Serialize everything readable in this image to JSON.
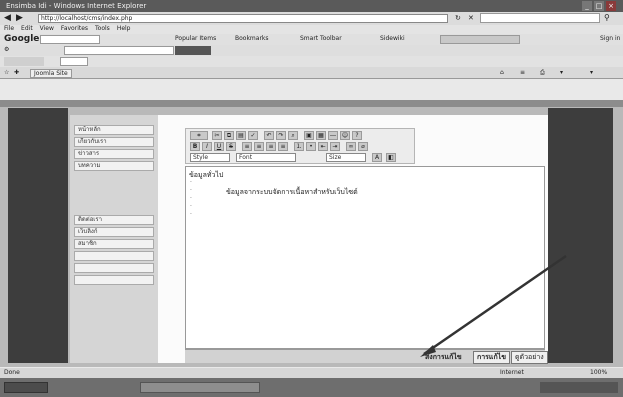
{
  "browser": {
    "title": "Ensimba Idi - Windows Internet Explorer",
    "url": "http://localhost/cms/index.php",
    "menu": [
      "File",
      "Edit",
      "View",
      "Favorites",
      "Tools",
      "Help"
    ],
    "search_brand": "Google",
    "toolbar_labels": [
      "Popular Items",
      "Bookmarks",
      "Smart Toolbar",
      "Sidewiki",
      "Sign in"
    ],
    "fav_tab": "Joomla Site"
  },
  "sidebar": {
    "items": [
      "หน้าหลัก",
      "เกี่ยวกับเรา",
      "ข่าวสาร",
      "บทความ",
      "ติดต่อเรา",
      "เว็บลิงก์",
      "สมาชิก"
    ]
  },
  "editor": {
    "style_select": "Style",
    "font_select": "Font",
    "size_select": "Size",
    "heading": "ข้อมูลทั่วไป",
    "body_text": "ข้อมูลจากระบบจัดการเนื้อหาสำหรับเว็บไซต์"
  },
  "bottom": {
    "label": "ส่งการแก้ไข",
    "save_button": "การแก้ไข",
    "preview_button": "ดูตัวอย่าง"
  },
  "status": {
    "left": "Done",
    "zone": "Internet",
    "zoom": "100%"
  },
  "colors": {
    "dark_panel": "#3d3d3d",
    "page_bg": "#b9b9b9"
  }
}
